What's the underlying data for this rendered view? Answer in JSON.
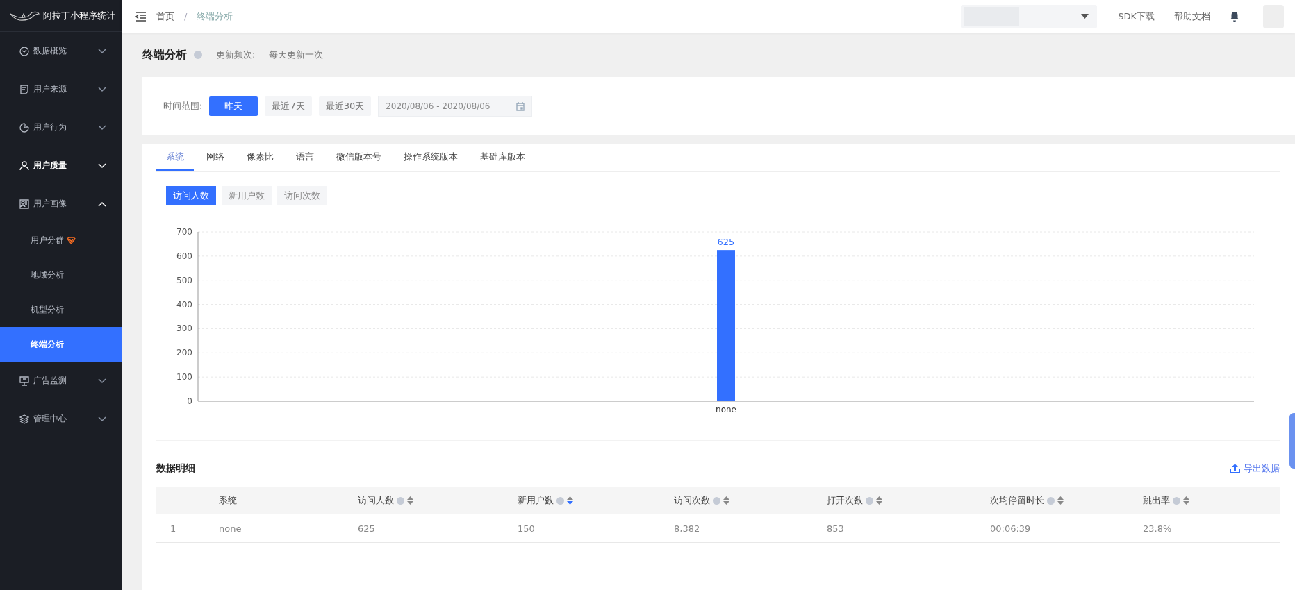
{
  "sidebar": {
    "logo_text": "阿拉丁小程序统计",
    "items": [
      {
        "label": "数据概览",
        "hovered": false,
        "expanded": false
      },
      {
        "label": "用户来源",
        "hovered": false,
        "expanded": false
      },
      {
        "label": "用户行为",
        "hovered": false,
        "expanded": false
      },
      {
        "label": "用户质量",
        "hovered": true,
        "expanded": false
      },
      {
        "label": "用户画像",
        "hovered": false,
        "expanded": true,
        "children": [
          {
            "label": "用户分群",
            "premium": true,
            "selected": false
          },
          {
            "label": "地域分析",
            "premium": false,
            "selected": false
          },
          {
            "label": "机型分析",
            "premium": false,
            "selected": false
          },
          {
            "label": "终端分析",
            "premium": false,
            "selected": true
          }
        ]
      },
      {
        "label": "广告监测",
        "hovered": false,
        "expanded": false
      },
      {
        "label": "管理中心",
        "hovered": false,
        "expanded": false
      }
    ]
  },
  "header": {
    "breadcrumb": [
      "首页",
      "终端分析"
    ],
    "breadcrumb_separator": "/",
    "links": [
      "SDK下载",
      "帮助文档"
    ]
  },
  "page": {
    "title": "终端分析",
    "update_label": "更新频次:",
    "update_value": "每天更新一次"
  },
  "filter": {
    "label": "时间范围:",
    "ranges": [
      {
        "label": "昨天",
        "selected": true
      },
      {
        "label": "最近7天",
        "selected": false
      },
      {
        "label": "最近30天",
        "selected": false
      }
    ],
    "date_range": "2020/08/06 - 2020/08/06"
  },
  "tabs": [
    {
      "label": "系统",
      "selected": true
    },
    {
      "label": "网络",
      "selected": false
    },
    {
      "label": "像素比",
      "selected": false
    },
    {
      "label": "语言",
      "selected": false
    },
    {
      "label": "微信版本号",
      "selected": false
    },
    {
      "label": "操作系统版本",
      "selected": false
    },
    {
      "label": "基础库版本",
      "selected": false
    }
  ],
  "metrics": [
    {
      "label": "访问人数",
      "selected": true
    },
    {
      "label": "新用户数",
      "selected": false
    },
    {
      "label": "访问次数",
      "selected": false
    }
  ],
  "chart_data": {
    "type": "bar",
    "categories": [
      "none"
    ],
    "values": [
      625
    ],
    "ylim": [
      0,
      700
    ],
    "yticks": [
      0,
      100,
      200,
      300,
      400,
      500,
      600,
      700
    ],
    "grid": true,
    "data_labels": true
  },
  "table": {
    "title": "数据明细",
    "export": "导出数据",
    "columns": [
      {
        "label": "系统",
        "kind": "plain"
      },
      {
        "label": "访问人数",
        "kind": "metric",
        "sort_desc": false
      },
      {
        "label": "新用户数",
        "kind": "metric",
        "sort_desc": true
      },
      {
        "label": "访问次数",
        "kind": "metric",
        "sort_desc": false
      },
      {
        "label": "打开次数",
        "kind": "metric",
        "sort_desc": false
      },
      {
        "label": "次均停留时长",
        "kind": "metric",
        "sort_desc": false
      },
      {
        "label": "跳出率",
        "kind": "metric",
        "sort_desc": false
      }
    ],
    "rows": [
      {
        "index": "1",
        "cells": [
          "none",
          "625",
          "150",
          "8,382",
          "853",
          "00:06:39",
          "23.8%"
        ]
      }
    ]
  }
}
